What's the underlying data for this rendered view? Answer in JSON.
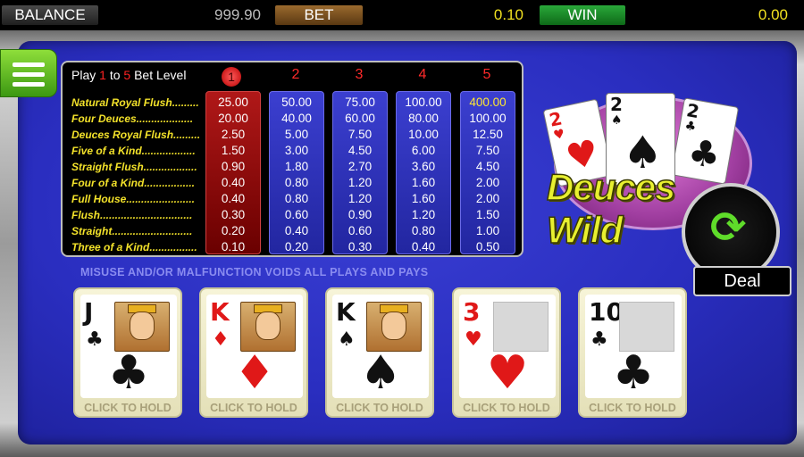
{
  "topbar": {
    "balance_label": "BALANCE",
    "balance_value": "999.90",
    "bet_label": "BET",
    "bet_value": "0.10",
    "win_label": "WIN",
    "win_value": "0.00"
  },
  "paytable": {
    "play_prefix": "Play",
    "play_min": "1",
    "play_to": "to",
    "play_max": "5",
    "play_suffix": "Bet Level",
    "levels": [
      "1",
      "2",
      "3",
      "4",
      "5"
    ],
    "active_level": "1",
    "hands": [
      "Natural Royal Flush.........",
      "Four Deuces...................",
      "Deuces Royal Flush.........",
      "Five of a Kind..................",
      "Straight Flush..................",
      "Four of a Kind.................",
      "Full House.......................",
      "Flush...............................",
      "Straight...........................",
      "Three of a Kind................"
    ],
    "columns": [
      [
        "25.00",
        "20.00",
        "2.50",
        "1.50",
        "0.90",
        "0.40",
        "0.40",
        "0.30",
        "0.20",
        "0.10"
      ],
      [
        "50.00",
        "40.00",
        "5.00",
        "3.00",
        "1.80",
        "0.80",
        "0.80",
        "0.60",
        "0.40",
        "0.20"
      ],
      [
        "75.00",
        "60.00",
        "7.50",
        "4.50",
        "2.70",
        "1.20",
        "1.20",
        "0.90",
        "0.60",
        "0.30"
      ],
      [
        "100.00",
        "80.00",
        "10.00",
        "6.00",
        "3.60",
        "1.60",
        "1.60",
        "1.20",
        "0.80",
        "0.40"
      ],
      [
        "400.00",
        "100.00",
        "12.50",
        "7.50",
        "4.50",
        "2.00",
        "2.00",
        "1.50",
        "1.00",
        "0.50"
      ]
    ]
  },
  "notice": "MISUSE AND/OR MALFUNCTION VOIDS ALL PLAYS AND PAYS",
  "logo": {
    "text": "Deuces Wild",
    "cards": [
      {
        "rank": "2",
        "suit": "♥"
      },
      {
        "rank": "2",
        "suit": "♠"
      },
      {
        "rank": "2",
        "suit": "♣"
      }
    ]
  },
  "deal": {
    "icon": "refresh-icon",
    "label": "Deal"
  },
  "cards": [
    {
      "rank": "J",
      "suit": "♣",
      "color": "black",
      "court": true,
      "hold": "CLICK TO HOLD"
    },
    {
      "rank": "K",
      "suit": "♦",
      "color": "red",
      "court": true,
      "hold": "CLICK TO HOLD"
    },
    {
      "rank": "K",
      "suit": "♠",
      "color": "black",
      "court": true,
      "hold": "CLICK TO HOLD"
    },
    {
      "rank": "3",
      "suit": "♥",
      "color": "red",
      "court": false,
      "hold": "CLICK TO HOLD"
    },
    {
      "rank": "10",
      "suit": "♣",
      "color": "black",
      "court": false,
      "hold": "CLICK TO HOLD"
    }
  ],
  "colors": {
    "felt": "#2a2ec0",
    "accent_yellow": "#f0e020",
    "win_green": "#1f8a2a",
    "bet_brown": "#7a5020"
  }
}
